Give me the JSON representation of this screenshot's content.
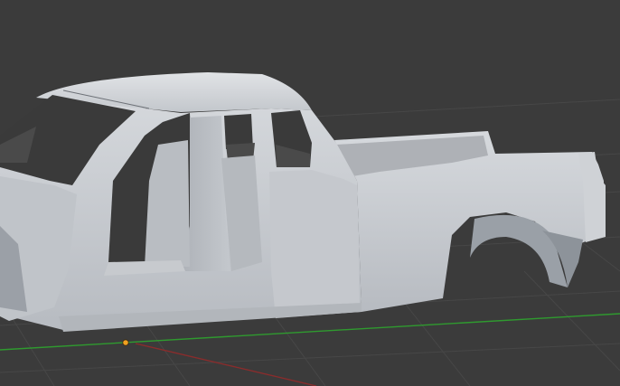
{
  "viewport": {
    "background": "#3b3b3b",
    "grid_color": "#4a4a4a",
    "x_axis_color": "#2f9a2f",
    "y_axis_color": "#9a3030",
    "origin_color": "#f0a020",
    "model_color": "#c9ccd1"
  }
}
